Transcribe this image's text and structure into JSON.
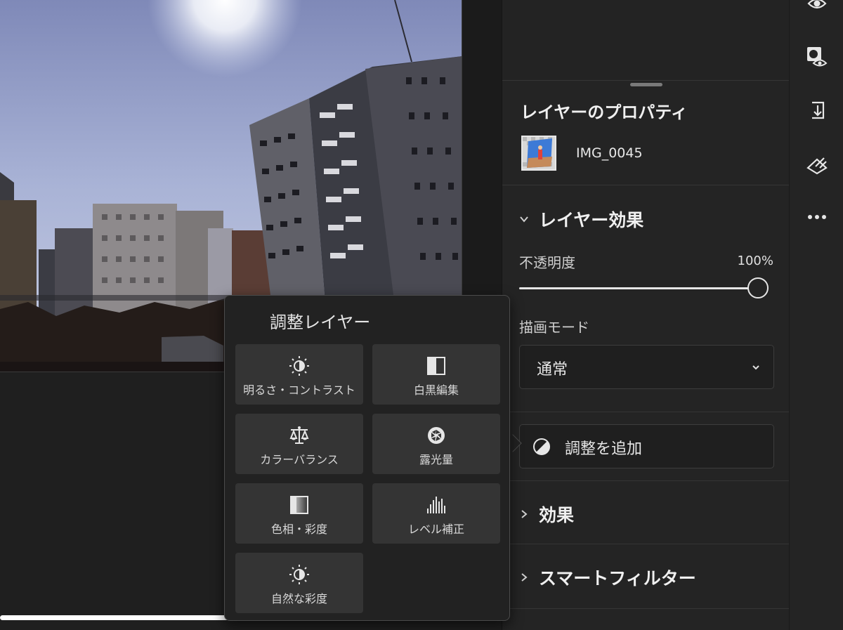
{
  "canvas": {},
  "properties": {
    "title": "レイヤーのプロパティ",
    "layer_name": "IMG_0045",
    "layer_effects": {
      "label": "レイヤー効果",
      "opacity_label": "不透明度",
      "opacity_value": "100%",
      "opacity_fraction": 1.0,
      "blend_label": "描画モード",
      "blend_value": "通常"
    },
    "add_adjustment_label": "調整を追加",
    "effects_label": "効果",
    "smart_filters_label": "スマートフィルター"
  },
  "toolbar": {
    "icons": [
      "visibility-eye-icon",
      "mask-visibility-icon",
      "import-layer-icon",
      "clear-layer-icon",
      "more-options-icon"
    ]
  },
  "popover": {
    "title": "調整レイヤー",
    "tiles": [
      {
        "label": "明るさ・コントラスト",
        "icon": "brightness-contrast-icon"
      },
      {
        "label": "白黒編集",
        "icon": "black-white-icon"
      },
      {
        "label": "カラーバランス",
        "icon": "color-balance-icon"
      },
      {
        "label": "露光量",
        "icon": "exposure-icon"
      },
      {
        "label": "色相・彩度",
        "icon": "hue-saturation-icon"
      },
      {
        "label": "レベル補正",
        "icon": "levels-icon"
      },
      {
        "label": "自然な彩度",
        "icon": "vibrance-icon"
      }
    ]
  },
  "colors": {
    "panel_bg": "#242424",
    "tile_bg": "#343434",
    "accent_text": "#f0f0f0"
  }
}
